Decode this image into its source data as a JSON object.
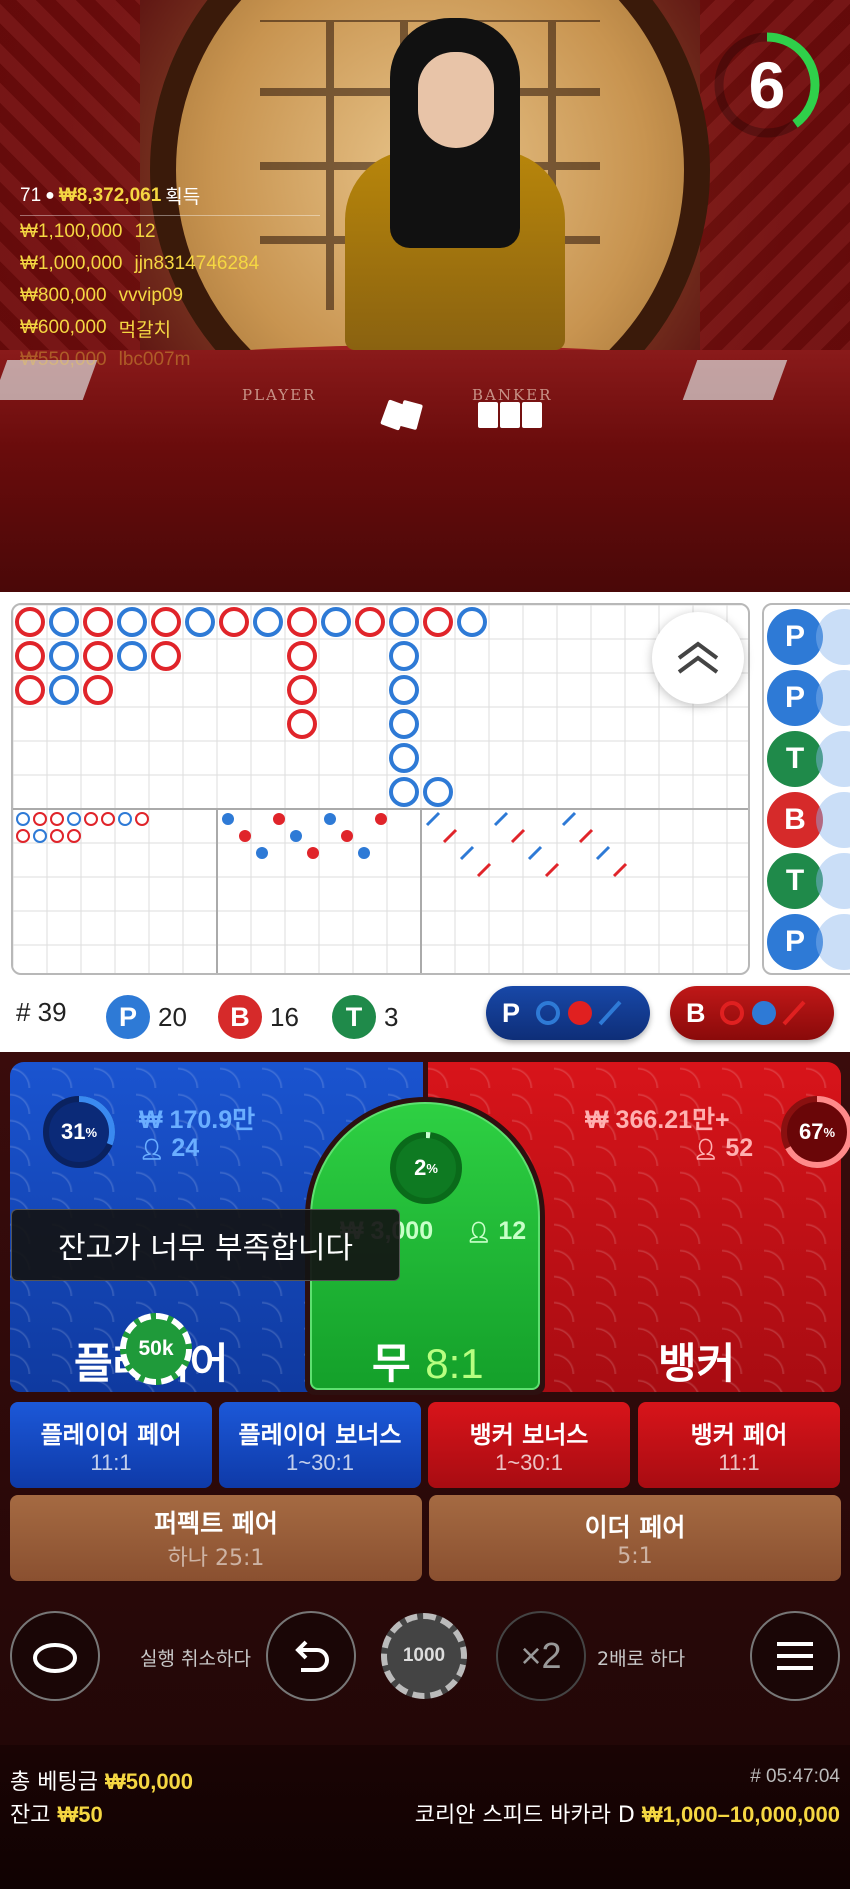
{
  "timer": {
    "seconds": "6",
    "remaining_fraction": 0.4
  },
  "winners": {
    "count": "71",
    "total_amount": "₩8,372,061",
    "total_suffix": "획득",
    "rows": [
      {
        "amount": "₩1,100,000",
        "name": "12"
      },
      {
        "amount": "₩1,000,000",
        "name": "jjn8314746284"
      },
      {
        "amount": "₩800,000",
        "name": "vvvip09"
      },
      {
        "amount": "₩600,000",
        "name": "먹갈치"
      },
      {
        "amount": "₩550,000",
        "name": "lbc007m"
      }
    ]
  },
  "table_labels": {
    "player": "PLAYER",
    "banker": "BANKER"
  },
  "roadmap": {
    "side_beads": [
      "P",
      "P",
      "T",
      "B",
      "T",
      "P"
    ]
  },
  "stats": {
    "round_label": "# 39",
    "player_letter": "P",
    "player_count": "20",
    "banker_letter": "B",
    "banker_count": "16",
    "tie_letter": "T",
    "tie_count": "3",
    "player_ask_letter": "P",
    "banker_ask_letter": "B"
  },
  "betting": {
    "player": {
      "percent": "31",
      "percent_sign": "%",
      "percent_value": 0.31,
      "amount": "₩ 170.9만",
      "bettors": "24",
      "name": "플레이어"
    },
    "banker": {
      "percent": "67",
      "percent_sign": "%",
      "percent_value": 0.67,
      "amount": "₩ 366.21만+",
      "bettors": "52",
      "name": "뱅커"
    },
    "tie": {
      "percent": "2",
      "percent_sign": "%",
      "percent_value": 0.02,
      "amount": "₩ 3,000",
      "bettors": "12",
      "name": "무",
      "odds": "8:1"
    },
    "placed_chip": "50k",
    "toast": "잔고가 너무 부족합니다",
    "side_bets": [
      {
        "name": "플레이어 페어",
        "odds": "11:1"
      },
      {
        "name": "플레이어 보너스",
        "odds": "1~30:1"
      },
      {
        "name": "뱅커 보너스",
        "odds": "1~30:1"
      },
      {
        "name": "뱅커 페어",
        "odds": "11:1"
      }
    ],
    "pair_bets": [
      {
        "name": "퍼펙트 페어",
        "odds": "하나 25:1"
      },
      {
        "name": "이더 페어",
        "odds": "5:1"
      }
    ]
  },
  "controls": {
    "undo_label": "실행 취소하다",
    "chip_value": "1000",
    "double_symbol": "×2",
    "double_label": "2배로 하다"
  },
  "footer": {
    "total_bet_label": "총 베팅금",
    "total_bet_value": "₩50,000",
    "balance_label": "잔고",
    "balance_value": "₩50",
    "game_id": "# 05:47:04",
    "table_name": "코리안 스피드 바카라 D",
    "limits": "₩1,000–10,000,000"
  },
  "colors": {
    "player_blue": "#1a54d0",
    "banker_red": "#d8141a",
    "tie_green": "#2ed043",
    "gold": "#f5d742"
  }
}
